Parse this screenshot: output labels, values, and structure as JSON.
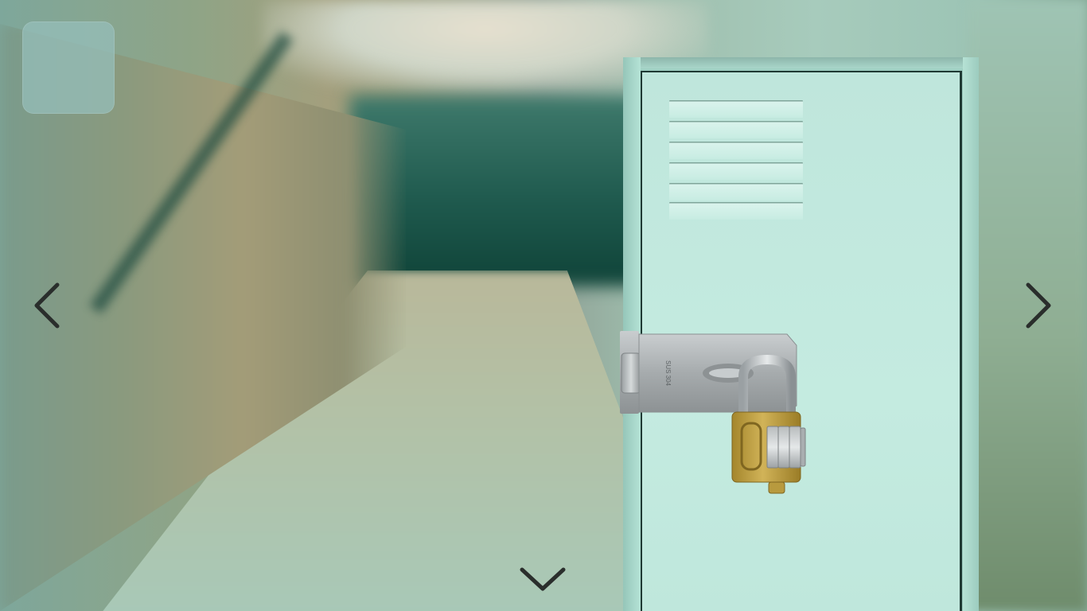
{
  "scene": {
    "name": "school-hallway-locker",
    "colors": {
      "locker": "#bfe6dc",
      "far_wall": "#1f5a4e",
      "floor": "#b3c1a6",
      "hasp_steel": "#a9aeb0",
      "padlock_brass": "#c2a443"
    }
  },
  "inventory": {
    "slots": [
      {
        "item": ""
      }
    ]
  },
  "navigation": {
    "left_icon": "chevron-left-icon",
    "right_icon": "chevron-right-icon",
    "down_icon": "chevron-down-icon"
  },
  "locker": {
    "vent_count": 6,
    "hasp_label": "SUS 304"
  }
}
